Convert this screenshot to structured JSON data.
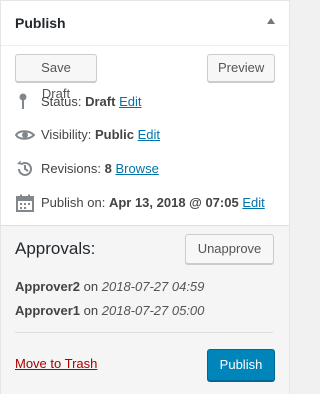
{
  "panel": {
    "title": "Publish"
  },
  "actions": {
    "save_draft": "Save Draft",
    "preview": "Preview"
  },
  "status": {
    "label": "Status:",
    "value": "Draft",
    "edit": "Edit"
  },
  "visibility": {
    "label": "Visibility:",
    "value": "Public",
    "edit": "Edit"
  },
  "revisions": {
    "label": "Revisions:",
    "value": "8",
    "browse": "Browse"
  },
  "schedule": {
    "label": "Publish on:",
    "value": "Apr 13, 2018 @ 07:05",
    "edit": "Edit"
  },
  "approvals": {
    "title": "Approvals:",
    "unapprove": "Unapprove",
    "items": [
      {
        "name": "Approver2",
        "on": "on",
        "date": "2018-07-27 04:59"
      },
      {
        "name": "Approver1",
        "on": "on",
        "date": "2018-07-27 05:00"
      }
    ]
  },
  "footer": {
    "trash": "Move to Trash",
    "publish": "Publish"
  },
  "colors": {
    "link": "#0073aa",
    "primary": "#0085ba",
    "danger": "#a00"
  },
  "icons": [
    "pin-icon",
    "eye-icon",
    "history-icon",
    "calendar-icon",
    "collapse-arrow-icon"
  ]
}
